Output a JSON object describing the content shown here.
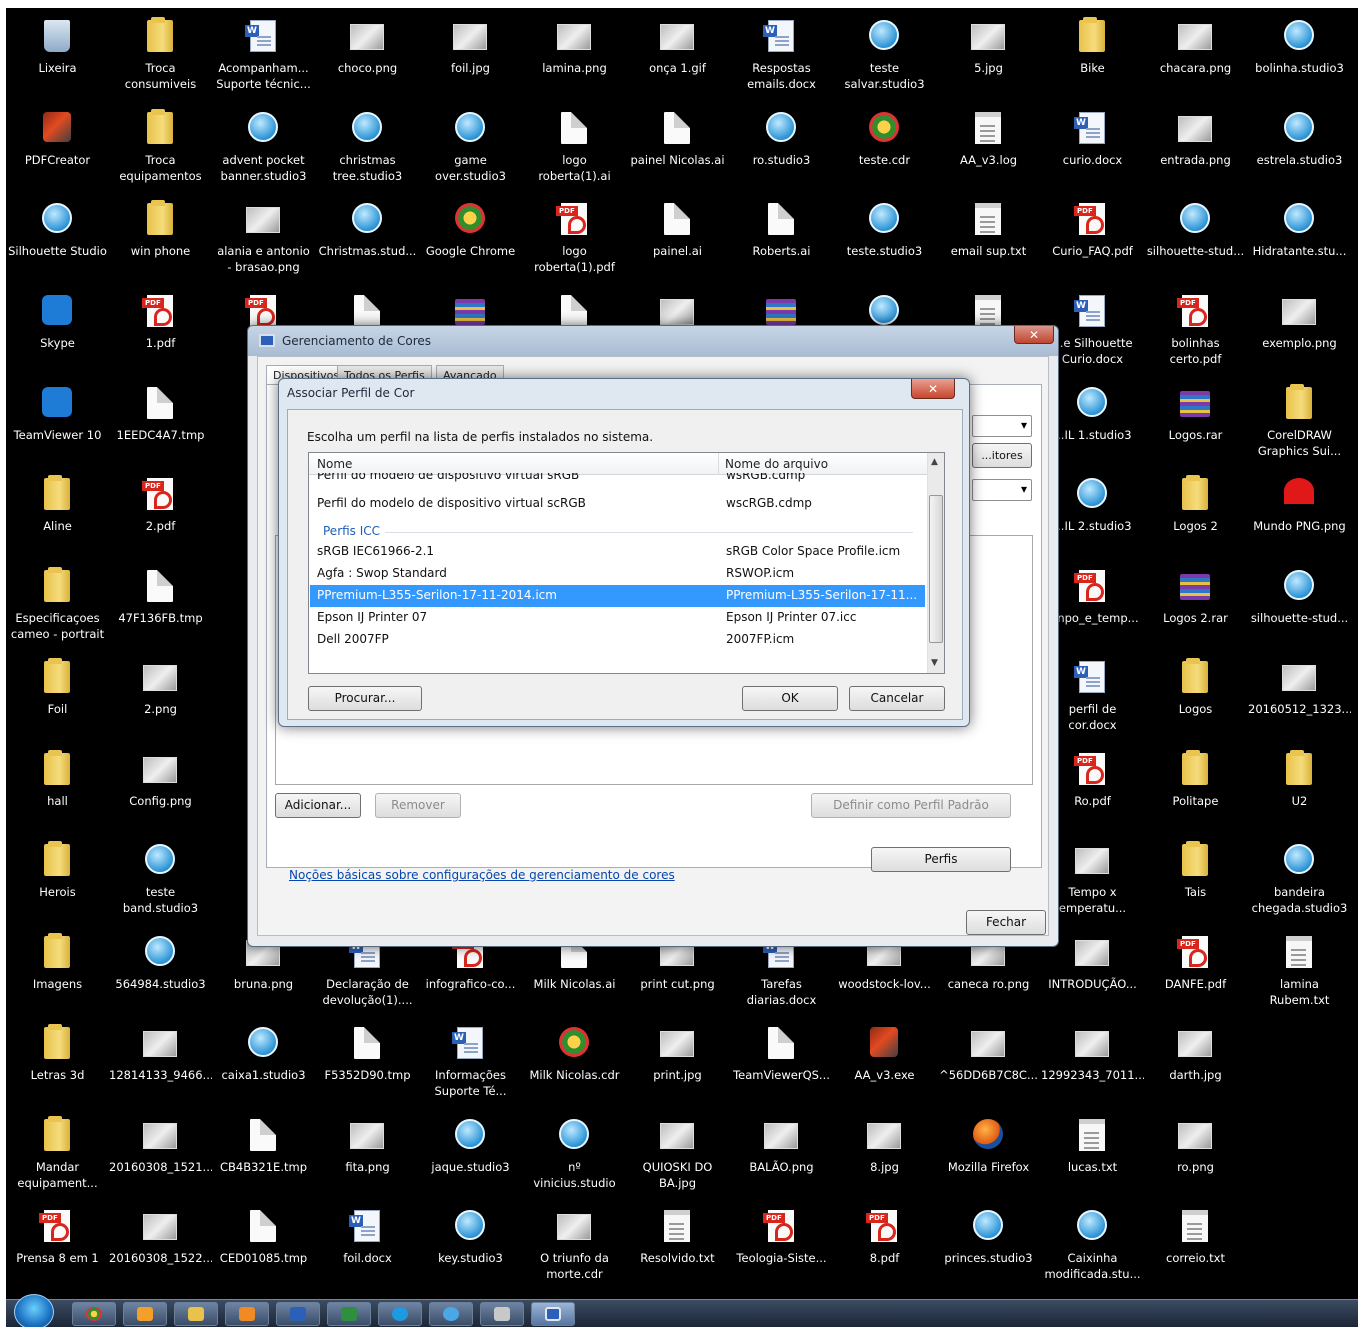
{
  "desktop": {
    "icons": [
      {
        "label": "Lixeira",
        "g": "tr"
      },
      {
        "label": "Troca\nconsumiveis",
        "g": "f"
      },
      {
        "label": "Acompanham...\nSuporte técnic...",
        "g": "w"
      },
      {
        "label": "choco.png",
        "g": "i"
      },
      {
        "label": "foil.jpg",
        "g": "i"
      },
      {
        "label": "lamina.png",
        "g": "i"
      },
      {
        "label": "onça 1.gif",
        "g": "i"
      },
      {
        "label": "Respostas\nemails.docx",
        "g": "w"
      },
      {
        "label": "teste\nsalvar.studio3",
        "g": "s"
      },
      {
        "label": "5.jpg",
        "g": "i"
      },
      {
        "label": "Bike",
        "g": "f"
      },
      {
        "label": "chacara.png",
        "g": "i"
      },
      {
        "label": "bolinha.studio3",
        "g": "s"
      },
      {
        "label": "PDFCreator",
        "g": "c"
      },
      {
        "label": "Troca\nequipamentos",
        "g": "f"
      },
      {
        "label": "advent pocket\nbanner.studio3",
        "g": "s"
      },
      {
        "label": "christmas\ntree.studio3",
        "g": "s"
      },
      {
        "label": "game\nover.studio3",
        "g": "s"
      },
      {
        "label": "logo\nroberta(1).ai",
        "g": "a"
      },
      {
        "label": "painel Nicolas.ai",
        "g": "a"
      },
      {
        "label": "ro.studio3",
        "g": "s"
      },
      {
        "label": "teste.cdr",
        "g": "x"
      },
      {
        "label": "AA_v3.log",
        "g": "t"
      },
      {
        "label": "curio.docx",
        "g": "w"
      },
      {
        "label": "entrada.png",
        "g": "i"
      },
      {
        "label": "estrela.studio3",
        "g": "s"
      },
      {
        "label": "Silhouette Studio",
        "g": "s"
      },
      {
        "label": "win phone",
        "g": "f"
      },
      {
        "label": "alania e antonio\n- brasao.png",
        "g": "i"
      },
      {
        "label": "Christmas.stud...",
        "g": "s"
      },
      {
        "label": "Google Chrome",
        "g": "x"
      },
      {
        "label": "logo\nroberta(1).pdf",
        "g": "p"
      },
      {
        "label": "painel.ai",
        "g": "a"
      },
      {
        "label": "Roberts.ai",
        "g": "a"
      },
      {
        "label": "teste.studio3",
        "g": "s"
      },
      {
        "label": "email sup.txt",
        "g": "t"
      },
      {
        "label": "Curio_FAQ.pdf",
        "g": "p"
      },
      {
        "label": "silhouette-stud...",
        "g": "s"
      },
      {
        "label": "Hidratante.stu...",
        "g": "s"
      },
      {
        "label": "Skype",
        "g": "b"
      },
      {
        "label": "1.pdf",
        "g": "p"
      },
      {
        "label": "",
        "g": "p"
      },
      {
        "label": "",
        "g": "a"
      },
      {
        "label": "",
        "g": "z"
      },
      {
        "label": "",
        "g": "a"
      },
      {
        "label": "",
        "g": "i"
      },
      {
        "label": "",
        "g": "z"
      },
      {
        "label": "",
        "g": "s"
      },
      {
        "label": "",
        "g": "t"
      },
      {
        "label": "...e Silhouette\nCurio.docx",
        "g": "w"
      },
      {
        "label": "bolinhas\ncerto.pdf",
        "g": "p"
      },
      {
        "label": "exemplo.png",
        "g": "i"
      },
      {
        "label": "TeamViewer 10",
        "g": "b"
      },
      {
        "label": "1EEDC4A7.tmp",
        "g": "a"
      },
      {
        "label": "",
        "g": "a"
      },
      {
        "label": "",
        "g": "a"
      },
      {
        "label": "",
        "g": "a"
      },
      {
        "label": "",
        "g": "a"
      },
      {
        "label": "",
        "g": "a"
      },
      {
        "label": "",
        "g": "a"
      },
      {
        "label": "",
        "g": "a"
      },
      {
        "label": "",
        "g": "a"
      },
      {
        "label": "...IL 1.studio3",
        "g": "s"
      },
      {
        "label": "Logos.rar",
        "g": "z"
      },
      {
        "label": "CorelDRAW\nGraphics Sui...",
        "g": "f"
      },
      {
        "label": "Aline",
        "g": "f"
      },
      {
        "label": "2.pdf",
        "g": "p"
      },
      {
        "label": "",
        "g": "a"
      },
      {
        "label": "",
        "g": "a"
      },
      {
        "label": "",
        "g": "a"
      },
      {
        "label": "",
        "g": "a"
      },
      {
        "label": "",
        "g": "a"
      },
      {
        "label": "",
        "g": "a"
      },
      {
        "label": "",
        "g": "a"
      },
      {
        "label": "",
        "g": "a"
      },
      {
        "label": "...IL 2.studio3",
        "g": "s"
      },
      {
        "label": "Logos 2",
        "g": "f"
      },
      {
        "label": "Mundo PNG.png",
        "g": "h"
      },
      {
        "label": "Especificaçoes\ncameo - portrait",
        "g": "f"
      },
      {
        "label": "47F136FB.tmp",
        "g": "a"
      },
      {
        "label": "",
        "g": "a"
      },
      {
        "label": "",
        "g": "a"
      },
      {
        "label": "",
        "g": "a"
      },
      {
        "label": "",
        "g": "a"
      },
      {
        "label": "",
        "g": "a"
      },
      {
        "label": "",
        "g": "a"
      },
      {
        "label": "",
        "g": "a"
      },
      {
        "label": "",
        "g": "a"
      },
      {
        "label": "...npo_e_temp...",
        "g": "p"
      },
      {
        "label": "Logos 2.rar",
        "g": "z"
      },
      {
        "label": "silhouette-stud...",
        "g": "s"
      },
      {
        "label": "Foil",
        "g": "f"
      },
      {
        "label": "2.png",
        "g": "i"
      },
      {
        "label": "",
        "g": "a"
      },
      {
        "label": "",
        "g": "a"
      },
      {
        "label": "",
        "g": "a"
      },
      {
        "label": "",
        "g": "a"
      },
      {
        "label": "",
        "g": "a"
      },
      {
        "label": "",
        "g": "a"
      },
      {
        "label": "",
        "g": "a"
      },
      {
        "label": "",
        "g": "a"
      },
      {
        "label": "perfil de\ncor.docx",
        "g": "w"
      },
      {
        "label": "Logos",
        "g": "f"
      },
      {
        "label": "20160512_1323...",
        "g": "i"
      },
      {
        "label": "hall",
        "g": "f"
      },
      {
        "label": "Config.png",
        "g": "i"
      },
      {
        "label": "",
        "g": "a"
      },
      {
        "label": "",
        "g": "a"
      },
      {
        "label": "",
        "g": "a"
      },
      {
        "label": "",
        "g": "a"
      },
      {
        "label": "",
        "g": "a"
      },
      {
        "label": "",
        "g": "a"
      },
      {
        "label": "",
        "g": "a"
      },
      {
        "label": "",
        "g": "a"
      },
      {
        "label": "Ro.pdf",
        "g": "p"
      },
      {
        "label": "Politape",
        "g": "f"
      },
      {
        "label": "U2",
        "g": "f"
      },
      {
        "label": "Herois",
        "g": "f"
      },
      {
        "label": "teste\nband.studio3",
        "g": "s"
      },
      {
        "label": "",
        "g": "a"
      },
      {
        "label": "",
        "g": "a"
      },
      {
        "label": "",
        "g": "a"
      },
      {
        "label": "",
        "g": "a"
      },
      {
        "label": "",
        "g": "a"
      },
      {
        "label": "",
        "g": "a"
      },
      {
        "label": "",
        "g": "a"
      },
      {
        "label": "",
        "g": "a"
      },
      {
        "label": "Tempo x\nemperatu...",
        "g": "i"
      },
      {
        "label": "Tais",
        "g": "f"
      },
      {
        "label": "bandeira\nchegada.studio3",
        "g": "s"
      },
      {
        "label": "Imagens",
        "g": "f"
      },
      {
        "label": "564984.studio3",
        "g": "s"
      },
      {
        "label": "bruna.png",
        "g": "i"
      },
      {
        "label": "Declaração de\ndevolução(1)....",
        "g": "w"
      },
      {
        "label": "infografico-co...",
        "g": "p"
      },
      {
        "label": "Milk Nicolas.ai",
        "g": "a"
      },
      {
        "label": "print cut.png",
        "g": "i"
      },
      {
        "label": "Tarefas\ndiarias.docx",
        "g": "w"
      },
      {
        "label": "woodstock-lov...",
        "g": "i"
      },
      {
        "label": "caneca ro.png",
        "g": "i"
      },
      {
        "label": "INTRODUÇÃO...",
        "g": "i"
      },
      {
        "label": "DANFE.pdf",
        "g": "p"
      },
      {
        "label": "lamina\nRubem.txt",
        "g": "t"
      },
      {
        "label": "Letras 3d",
        "g": "f"
      },
      {
        "label": "12814133_9466...",
        "g": "i"
      },
      {
        "label": "caixa1.studio3",
        "g": "s"
      },
      {
        "label": "F5352D90.tmp",
        "g": "a"
      },
      {
        "label": "Informações\nSuporte Té...",
        "g": "w"
      },
      {
        "label": "Milk Nicolas.cdr",
        "g": "x"
      },
      {
        "label": "print.jpg",
        "g": "i"
      },
      {
        "label": "TeamViewerQS...",
        "g": "a"
      },
      {
        "label": "AA_v3.exe",
        "g": "c"
      },
      {
        "label": "^56DD6B7C8C...",
        "g": "i"
      },
      {
        "label": "12992343_7011...",
        "g": "i"
      },
      {
        "label": "darth.jpg",
        "g": "i"
      },
      {
        "label": "",
        "g": ""
      },
      {
        "label": "Mandar\nequipament...",
        "g": "f"
      },
      {
        "label": "20160308_1521...",
        "g": "i"
      },
      {
        "label": "CB4B321E.tmp",
        "g": "a"
      },
      {
        "label": "fita.png",
        "g": "i"
      },
      {
        "label": "jaque.studio3",
        "g": "s"
      },
      {
        "label": "nº\nvinicius.studio",
        "g": "s"
      },
      {
        "label": "QUIOSKI DO\nBA.jpg",
        "g": "i"
      },
      {
        "label": "BALÃO.png",
        "g": "i"
      },
      {
        "label": "8.jpg",
        "g": "i"
      },
      {
        "label": "Mozilla Firefox",
        "g": "n"
      },
      {
        "label": "lucas.txt",
        "g": "t"
      },
      {
        "label": "ro.png",
        "g": "i"
      },
      {
        "label": "",
        "g": ""
      },
      {
        "label": "Prensa 8 em 1",
        "g": "p"
      },
      {
        "label": "20160308_1522...",
        "g": "i"
      },
      {
        "label": "CED01085.tmp",
        "g": "a"
      },
      {
        "label": "foil.docx",
        "g": "w"
      },
      {
        "label": "key.studio3",
        "g": "s"
      },
      {
        "label": "O triunfo da\nmorte.cdr",
        "g": "i"
      },
      {
        "label": "Resolvido.txt",
        "g": "t"
      },
      {
        "label": "Teologia-Siste...",
        "g": "p"
      },
      {
        "label": "8.pdf",
        "g": "p"
      },
      {
        "label": "princes.studio3",
        "g": "s"
      },
      {
        "label": "Caixinha\nmodificada.stu...",
        "g": "s"
      },
      {
        "label": "correio.txt",
        "g": "t"
      },
      {
        "label": "",
        "g": ""
      }
    ]
  },
  "color_window": {
    "title": "Gerenciamento de Cores",
    "close": "✕",
    "tabs": [
      "Dispositivos",
      "Todos os Perfis",
      "Avançado"
    ],
    "monitors_button": "...itores",
    "add_button": "Adicionar...",
    "remove_button": "Remover",
    "set_default_button": "Definir como Perfil Padrão",
    "profiles_button": "Perfis",
    "link": "Noções básicas sobre configurações de gerenciamento de cores",
    "close_button": "Fechar"
  },
  "dialog": {
    "title": "Associar Perfil de Cor",
    "close": "✕",
    "prompt": "Escolha um perfil na lista de perfis instalados no sistema.",
    "col_name": "Nome",
    "col_file": "Nome do arquivo",
    "rows_top": [
      {
        "name": "Perfil do modelo de dispositivo virtual sRGB",
        "file": "wsRGB.cdmp"
      },
      {
        "name": "Perfil do modelo de dispositivo virtual scRGB",
        "file": "wscRGB.cdmp"
      }
    ],
    "group": "Perfis ICC",
    "rows_icc": [
      {
        "name": "sRGB IEC61966-2.1",
        "file": "sRGB Color Space Profile.icm"
      },
      {
        "name": "Agfa : Swop Standard",
        "file": "RSWOP.icm"
      },
      {
        "name": "PPremium-L355-Serilon-17-11-2014.icm",
        "file": "PPremium-L355-Serilon-17-11..."
      },
      {
        "name": "Epson IJ Printer 07",
        "file": "Epson IJ Printer 07.icc"
      },
      {
        "name": "Dell 2007FP",
        "file": "2007FP.icm"
      }
    ],
    "browse_button": "Procurar...",
    "ok_button": "OK",
    "cancel_button": "Cancelar"
  }
}
